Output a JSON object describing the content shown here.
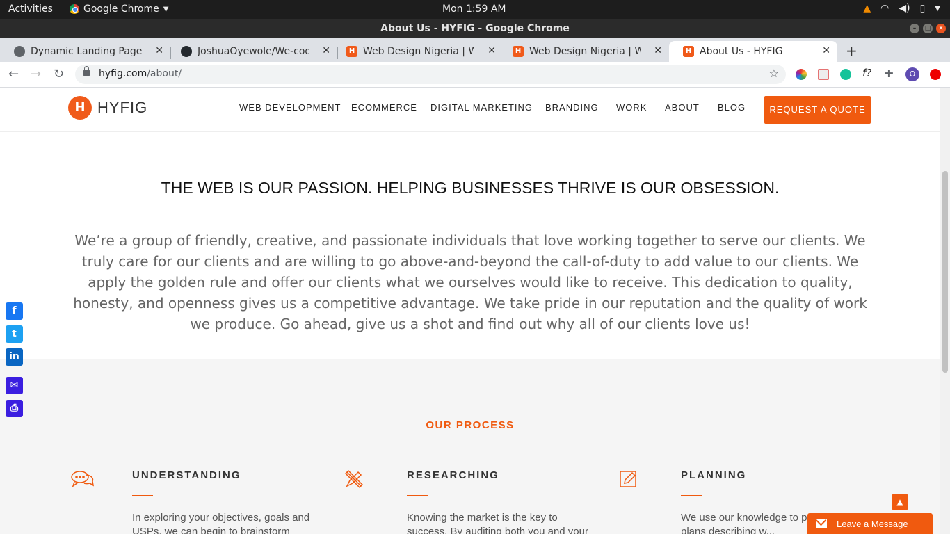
{
  "os": {
    "activities": "Activities",
    "app_name": "Google Chrome",
    "clock": "Mon  1:59 AM"
  },
  "window": {
    "title": "About Us - HYFIG - Google Chrome"
  },
  "tabs": [
    {
      "label": "Dynamic Landing Page",
      "icon": "globe-icon"
    },
    {
      "label": "JoshuaOyewole/We-code",
      "icon": "github-icon"
    },
    {
      "label": "Web Design Nigeria | Web",
      "icon": "hyfig-icon"
    },
    {
      "label": "Web Design Nigeria | Web",
      "icon": "hyfig-icon"
    },
    {
      "label": "About Us - HYFIG",
      "icon": "hyfig-icon",
      "active": true
    }
  ],
  "address": {
    "host": "hyfig.com",
    "path": "/about/"
  },
  "site": {
    "logo_text": "HYFIG",
    "menu": [
      "WEB DEVELOPMENT",
      "ECOMMERCE",
      "DIGITAL MARKETING",
      "BRANDING",
      "WORK",
      "ABOUT",
      "BLOG"
    ],
    "cta": "REQUEST A QUOTE",
    "headline": "THE WEB IS OUR PASSION. HELPING BUSINESSES THRIVE IS OUR OBSESSION.",
    "intro": "We’re a group of friendly, creative, and passionate individuals that love working together to serve our clients. We truly care for our clients and are willing to go above-and-beyond the call-of-duty to add value to our clients. We apply the golden rule and offer our clients what we ourselves would like to receive. This dedication to quality, honesty, and openness gives us a competitive advantage. We take pride in our reputation and the quality of work we produce. Go ahead, give us a shot and find out why all of our clients love us!",
    "process_title": "OUR PROCESS",
    "steps": [
      {
        "title": "UNDERSTANDING",
        "text": "In exploring your objectives, goals and USPs, we can begin to brainstorm",
        "icon": "chat-bubbles-icon"
      },
      {
        "title": "RESEARCHING",
        "text": "Knowing the market is the key to success. By auditing both you and your",
        "icon": "pencil-ruler-icon"
      },
      {
        "title": "PLANNING",
        "text": "We use our knowledge to p... detailed plans describing w...",
        "icon": "edit-icon"
      }
    ],
    "chat_widget": "Leave a Message"
  },
  "colors": {
    "brand": "#f05a0f",
    "social_facebook": "#1877f2",
    "social_twitter": "#1da1f2",
    "social_linkedin": "#0a66c2",
    "social_email": "#3b1ee0",
    "social_print": "#3b1ee0"
  }
}
